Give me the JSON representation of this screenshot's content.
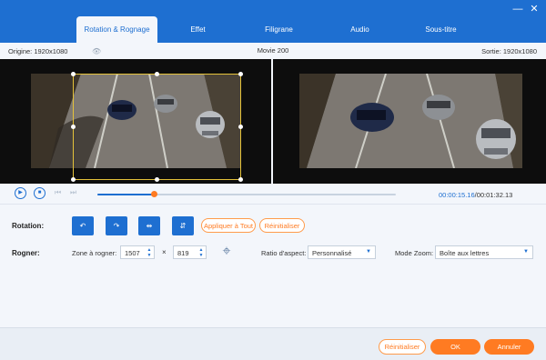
{
  "titlebar": {
    "tabs": [
      {
        "label": "Rotation & Rognage",
        "active": true
      },
      {
        "label": "Effet",
        "active": false
      },
      {
        "label": "Filigrane",
        "active": false
      },
      {
        "label": "Audio",
        "active": false
      },
      {
        "label": "Sous-titre",
        "active": false
      }
    ],
    "minimize_icon": "minimize-icon",
    "close_icon": "close-icon"
  },
  "infobar": {
    "origin": "Origine: 1920x1080",
    "movie": "Movie 200",
    "output": "Sortie: 1920x1080"
  },
  "player": {
    "current_time": "00:00:15.16",
    "total_time": "/00:01:32.13",
    "progress": 0.19
  },
  "rotation": {
    "label": "Rotation:",
    "apply_all": "Appliquer à Tout",
    "reset": "Réinitialiser"
  },
  "crop": {
    "label": "Rogner:",
    "zone_label": "Zone à rogner:",
    "width": "1507",
    "times": "×",
    "height": "819",
    "aspect_label": "Ratio d'aspect:",
    "aspect_value": "Personnalisé",
    "zoom_label": "Mode Zoom:",
    "zoom_value": "Boîte aux lettres"
  },
  "footer": {
    "reset": "Réinitialiser",
    "ok": "OK",
    "cancel": "Annuler"
  },
  "colors": {
    "accent": "#1e6fd1",
    "orange": "#ff7b22",
    "crop_frame": "#e4c23a"
  }
}
